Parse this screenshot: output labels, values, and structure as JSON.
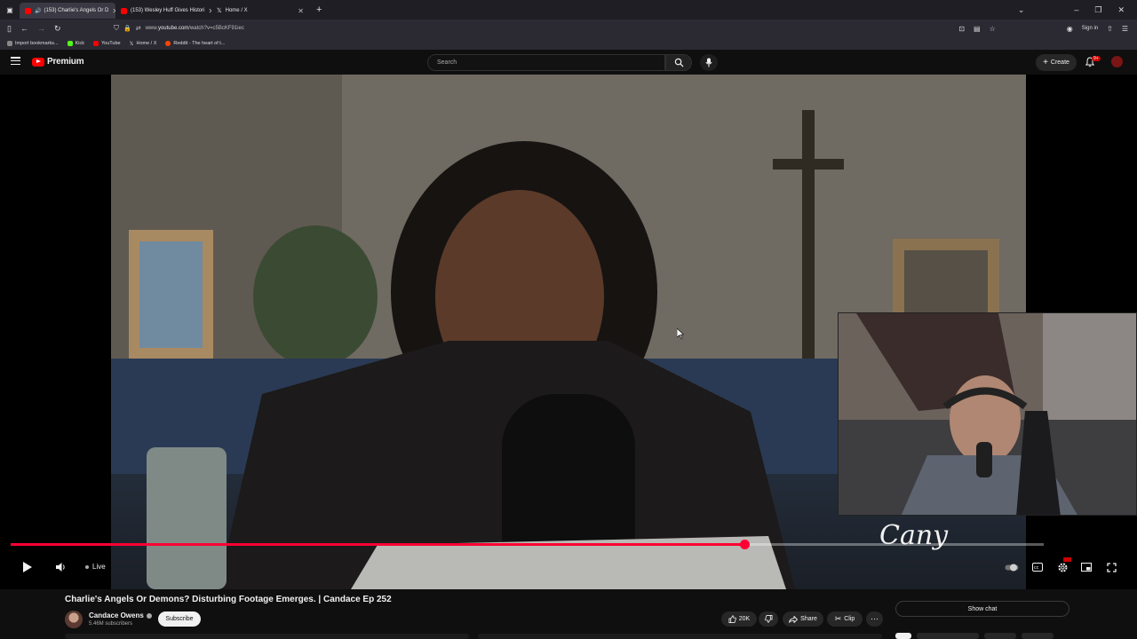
{
  "browser": {
    "tabs": [
      {
        "label": "(153) Charlie's Angels Or D",
        "active": true,
        "color": "#ff0000"
      },
      {
        "label": "(153) Wesley Huff Gives Histori",
        "active": false,
        "color": "#ff0000"
      },
      {
        "label": "Home / X",
        "active": false,
        "color": "#000000"
      }
    ],
    "new_tab": "+",
    "url_prefix": "www.",
    "url_domain": "youtube.com",
    "url_path": "/watch?v=c5BcKF91iec",
    "sign_in": "Sign in",
    "bookmarks": [
      {
        "label": "Import bookmarks...",
        "color": "#888888"
      },
      {
        "label": "Kick",
        "color": "#53fc18"
      },
      {
        "label": "YouTube",
        "color": "#ff0000"
      },
      {
        "label": "Home / X",
        "color": "#000000"
      },
      {
        "label": "Reddit - The heart of t...",
        "color": "#ff4500"
      }
    ]
  },
  "youtube": {
    "logo_text": "Premium",
    "search_placeholder": "Search",
    "create_label": "Create",
    "notifications_badge": "9+"
  },
  "player": {
    "live_label": "Live",
    "progress_fraction": 0.71,
    "signature_text": "Cany"
  },
  "video": {
    "title": "Charlie's Angels Or Demons? Disturbing Footage Emerges. | Candace Ep 252",
    "channel": "Candace Owens",
    "subscribers": "5.46M subscribers",
    "subscribe_label": "Subscribe",
    "likes": "20K",
    "share_label": "Share",
    "clip_label": "Clip",
    "show_chat_label": "Show chat"
  },
  "colors": {
    "accent": "#ff0033",
    "background": "#0f0f0f"
  }
}
